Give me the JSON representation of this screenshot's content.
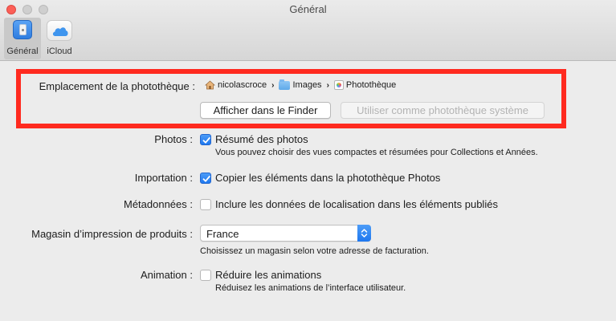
{
  "window": {
    "title": "Général"
  },
  "toolbar": {
    "general_label": "Général",
    "icloud_label": "iCloud"
  },
  "library": {
    "label": "Emplacement de la photothèque :",
    "path": [
      "nicolascroce",
      "Images",
      "Photothèque"
    ],
    "show_in_finder_label": "Afficher dans le Finder",
    "use_as_system_label": "Utiliser comme photothèque système"
  },
  "photos": {
    "label": "Photos :",
    "checkbox_label": "Résumé des photos",
    "checked": true,
    "description": "Vous pouvez choisir des vues compactes et résumées pour Collections et Années."
  },
  "import": {
    "label": "Importation :",
    "checkbox_label": "Copier les éléments dans la photothèque Photos",
    "checked": true
  },
  "metadata": {
    "label": "Métadonnées :",
    "checkbox_label": "Inclure les données de localisation dans les éléments publiés",
    "checked": false
  },
  "print_store": {
    "label": "Magasin d’impression de produits :",
    "selected": "France",
    "description": "Choisissez un magasin selon votre adresse de facturation."
  },
  "animation": {
    "label": "Animation :",
    "checkbox_label": "Réduire les animations",
    "checked": false,
    "description": "Réduisez les animations de l’interface utilisateur."
  },
  "colors": {
    "accent": "#1e77ef",
    "highlight": "#ff2a1f"
  }
}
